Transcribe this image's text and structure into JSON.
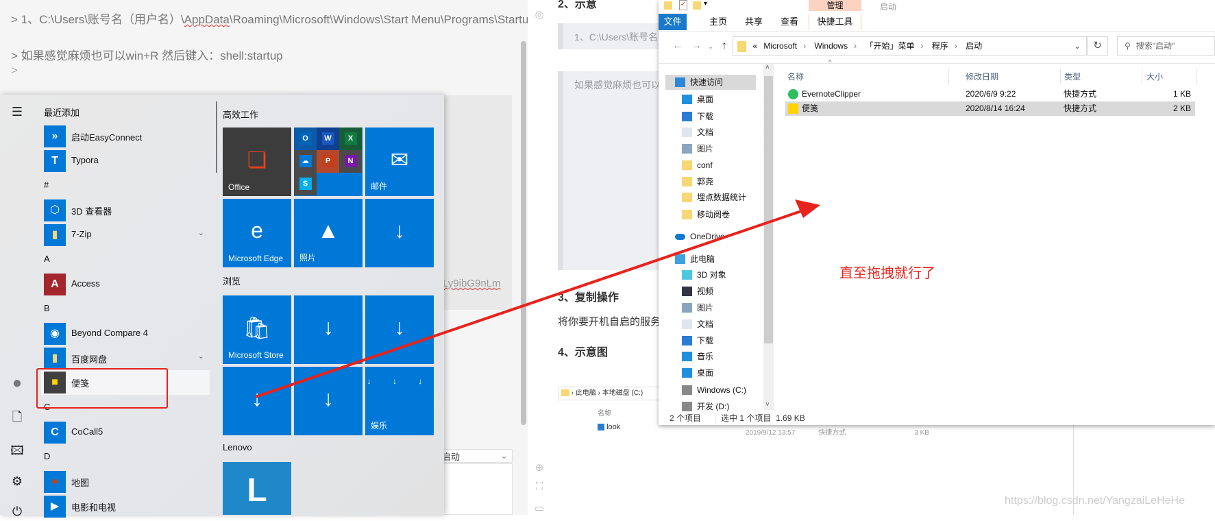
{
  "editor": {
    "line1_prefix": "> 1、C:\\Users\\账号名（用户名）\\",
    "line1_squiggle": "AppData",
    "line1_suffix": "\\Roaming\\Microsoft\\Windows\\Start Menu\\Programs\\Startup",
    "line2": "> 如果感觉麻烦也可以win+R 然后键入：shell:startup",
    "line3": ">",
    "code_fragment": "Ly9ibG9nLm",
    "dropdown_value": "启动"
  },
  "doc": {
    "heading2": "2、示意",
    "quote1": "1、C:\\Users\\账号名",
    "quote2": "如果感觉麻烦也可以",
    "heading3": "3、复制操作",
    "para": "将你要开机自启的服务",
    "heading4": "4、示意图",
    "mini_breadcrumb": [
      "此电脑",
      "本地磁盘 (C:)"
    ],
    "mini_col": "名称",
    "mini_file": "look",
    "mini_date": "2019/9/12 13:57",
    "mini_type": "快捷方式",
    "mini_size": "3 KB"
  },
  "start_menu": {
    "rail_icons": [
      "hamburger-menu-icon",
      "user-avatar-icon",
      "document-icon",
      "pictures-icon",
      "settings-gear-icon",
      "power-icon"
    ],
    "apps": [
      {
        "type": "header",
        "label": "最近添加"
      },
      {
        "type": "app",
        "label": "启动EasyConnect",
        "icon": "easyconnect-icon",
        "color": "#0078d7",
        "glyph": "»"
      },
      {
        "type": "app",
        "label": "Typora",
        "icon": "typora-icon",
        "color": "#0078d7",
        "glyph": "T"
      },
      {
        "type": "header",
        "label": "#"
      },
      {
        "type": "app",
        "label": "3D 查看器",
        "icon": "3d-viewer-icon",
        "color": "#0078d7",
        "glyph": "⬡"
      },
      {
        "type": "app",
        "label": "7-Zip",
        "icon": "folder-icon",
        "color": "#0078d7",
        "glyph": "▮",
        "expand": true
      },
      {
        "type": "header",
        "label": "A"
      },
      {
        "type": "app",
        "label": "Access",
        "icon": "access-icon",
        "color": "#a4262c",
        "glyph": "A"
      },
      {
        "type": "header",
        "label": "B"
      },
      {
        "type": "app",
        "label": "Beyond Compare 4",
        "icon": "beyond-compare-icon",
        "color": "#0078d7",
        "glyph": "◉"
      },
      {
        "type": "app",
        "label": "百度网盘",
        "icon": "folder-icon",
        "color": "#0078d7",
        "glyph": "▮",
        "expand": true
      },
      {
        "type": "app",
        "label": "便笺",
        "icon": "sticky-notes-icon",
        "color": "#404040",
        "glyph": "■",
        "selected": true
      },
      {
        "type": "header",
        "label": "C"
      },
      {
        "type": "app",
        "label": "CoCall5",
        "icon": "cocall-icon",
        "color": "#0078d7",
        "glyph": "C"
      },
      {
        "type": "header",
        "label": "D"
      },
      {
        "type": "app",
        "label": "地图",
        "icon": "maps-icon",
        "color": "#0078d7",
        "glyph": "●"
      },
      {
        "type": "app",
        "label": "电影和电视",
        "icon": "movies-tv-icon",
        "color": "#0078d7",
        "glyph": "▶"
      }
    ],
    "groups": [
      "高效工作",
      "浏览",
      "Lenovo"
    ],
    "tiles": [
      {
        "label": "Office",
        "icon": "office-icon",
        "color": "#3c3c3c",
        "glyph": "❏",
        "glyph_color": "#e5421e"
      },
      {
        "label": "",
        "icon": "office-apps-folder-icon",
        "color": "#0078d7",
        "folder": true
      },
      {
        "label": "邮件",
        "icon": "mail-icon",
        "color": "#0078d7",
        "glyph": "✉"
      },
      {
        "label": "Microsoft Edge",
        "icon": "edge-icon",
        "color": "#0078d7",
        "glyph": "e"
      },
      {
        "label": "照片",
        "icon": "photos-icon",
        "color": "#0078d7",
        "glyph": "▲"
      },
      {
        "label": "",
        "icon": "download-icon",
        "color": "#0078d7",
        "glyph": "↓"
      },
      {
        "label": "Microsoft Store",
        "icon": "store-icon",
        "color": "#0078d7",
        "glyph": "🛍"
      },
      {
        "label": "",
        "icon": "download-icon",
        "color": "#0078d7",
        "glyph": "↓"
      },
      {
        "label": "",
        "icon": "download-icon",
        "color": "#0078d7",
        "glyph": "↓"
      },
      {
        "label": "",
        "icon": "download-icon",
        "color": "#0078d7",
        "glyph": "↓"
      },
      {
        "label": "",
        "icon": "download-icon",
        "color": "#0078d7",
        "glyph": "↓"
      },
      {
        "label": "娱乐",
        "icon": "entertainment-folder-icon",
        "color": "#0078d7",
        "glyph": "↓ ↓ ↓"
      },
      {
        "label": "",
        "icon": "lenovo-icon",
        "color": "#1e88c8",
        "glyph": "L"
      }
    ],
    "office_folder": [
      {
        "g": "O",
        "c": "#0364b8",
        "bg": "#0a5aa8"
      },
      {
        "g": "W",
        "c": "#185abd",
        "bg": "#103f91"
      },
      {
        "g": "X",
        "c": "#107c41",
        "bg": "#185c37"
      },
      {
        "g": "☁",
        "c": "#0078d4",
        "bg": "#4a4a4a"
      },
      {
        "g": "P",
        "c": "#c43e1c",
        "bg": "#b7472a"
      },
      {
        "g": "N",
        "c": "#7719aa",
        "bg": "#4a4a4a"
      },
      {
        "g": "S",
        "c": "#00aff0",
        "bg": "#4a4a4a"
      }
    ]
  },
  "explorer": {
    "title": "启动",
    "context_tab_group": "管理",
    "ribbon_tabs": [
      "文件",
      "主页",
      "共享",
      "查看",
      "快捷工具"
    ],
    "breadcrumb": [
      "«",
      "Microsoft",
      "Windows",
      "「开始」菜单",
      "程序",
      "启动"
    ],
    "search_placeholder": "搜索\"启动\"",
    "nav": [
      {
        "label": "快速访问",
        "icon": "star-icon",
        "indent": 0,
        "selected": true
      },
      {
        "label": "桌面",
        "icon": "desktop-icon",
        "indent": 1,
        "pin": true
      },
      {
        "label": "下载",
        "icon": "download-icon",
        "indent": 1,
        "pin": true
      },
      {
        "label": "文档",
        "icon": "documents-icon",
        "indent": 1,
        "pin": true
      },
      {
        "label": "图片",
        "icon": "pictures-icon",
        "indent": 1,
        "pin": true
      },
      {
        "label": "conf",
        "icon": "folder-icon",
        "indent": 1
      },
      {
        "label": "郭尧",
        "icon": "folder-icon",
        "indent": 1
      },
      {
        "label": "埋点数据统计",
        "icon": "folder-icon",
        "indent": 1
      },
      {
        "label": "移动阅卷",
        "icon": "folder-icon",
        "indent": 1
      },
      {
        "label": "OneDrive",
        "icon": "onedrive-icon",
        "indent": 0,
        "gap": true
      },
      {
        "label": "此电脑",
        "icon": "this-pc-icon",
        "indent": 0,
        "gap": true
      },
      {
        "label": "3D 对象",
        "icon": "3d-objects-icon",
        "indent": 1
      },
      {
        "label": "视频",
        "icon": "videos-icon",
        "indent": 1
      },
      {
        "label": "图片",
        "icon": "pictures-icon",
        "indent": 1
      },
      {
        "label": "文档",
        "icon": "documents-icon",
        "indent": 1
      },
      {
        "label": "下载",
        "icon": "download-icon",
        "indent": 1
      },
      {
        "label": "音乐",
        "icon": "music-icon",
        "indent": 1
      },
      {
        "label": "桌面",
        "icon": "desktop-icon",
        "indent": 1
      },
      {
        "label": "Windows (C:)",
        "icon": "drive-c-icon",
        "indent": 1
      },
      {
        "label": "开发 (D:)",
        "icon": "drive-d-icon",
        "indent": 1
      }
    ],
    "columns": [
      "名称",
      "修改日期",
      "类型",
      "大小"
    ],
    "files": [
      {
        "name": "EvernoteClipper",
        "date": "2020/6/9 9:22",
        "type": "快捷方式",
        "size": "1 KB",
        "icon": "evernote-icon"
      },
      {
        "name": "便笺",
        "date": "2020/8/14 16:24",
        "type": "快捷方式",
        "size": "2 KB",
        "icon": "sticky-notes-icon",
        "selected": true
      }
    ],
    "status_count": "2 个项目",
    "status_selected": "选中 1 个项目  1.69 KB"
  },
  "annotation": {
    "text": "直至拖拽就行了",
    "color": "#e8221c"
  },
  "watermark": "https://blog.csdn.net/YangzaiLeHeHe",
  "colors": {
    "accent": "#0078d7",
    "file_tab": "#1979ca",
    "context_tab": "#fcd3c1",
    "selection": "#d9d9d9"
  }
}
